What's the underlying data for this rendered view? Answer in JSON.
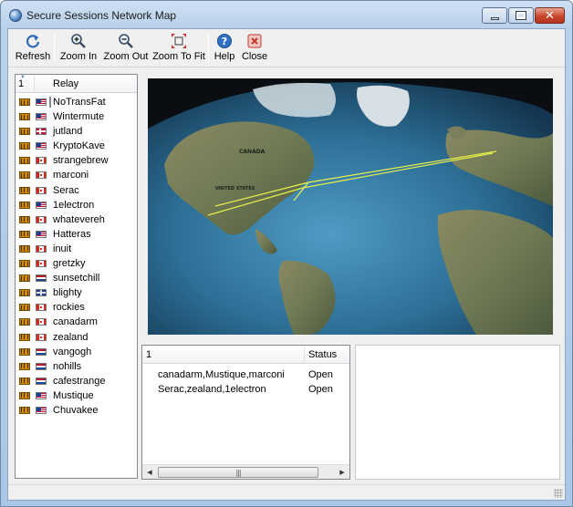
{
  "window": {
    "title": "Secure Sessions Network Map",
    "controls": {
      "minimize": "minimize",
      "maximize": "maximize",
      "close": "close"
    }
  },
  "toolbar": {
    "refresh_label": "Refresh",
    "zoom_in_label": "Zoom In",
    "zoom_out_label": "Zoom Out",
    "zoom_to_fit_label": "Zoom To Fit",
    "help_label": "Help",
    "close_label": "Close",
    "icons": {
      "refresh": "refresh-icon",
      "zoom_in": "magnifier-plus-icon",
      "zoom_out": "magnifier-minus-icon",
      "zoom_to_fit": "fit-arrows-icon",
      "help": "help-question-icon",
      "close": "close-x-icon"
    }
  },
  "relay_table": {
    "columns": {
      "count": "1",
      "relay": "Relay"
    },
    "rows": [
      {
        "name": "NoTransFat",
        "flag": "us"
      },
      {
        "name": "Wintermute",
        "flag": "us"
      },
      {
        "name": "jutland",
        "flag": "dk"
      },
      {
        "name": "KryptoKave",
        "flag": "us"
      },
      {
        "name": "strangebrew",
        "flag": "ca"
      },
      {
        "name": "marconi",
        "flag": "ca"
      },
      {
        "name": "Serac",
        "flag": "ca"
      },
      {
        "name": "1electron",
        "flag": "us"
      },
      {
        "name": "whatevereh",
        "flag": "ca"
      },
      {
        "name": "Hatteras",
        "flag": "us"
      },
      {
        "name": "inuit",
        "flag": "ca"
      },
      {
        "name": "gretzky",
        "flag": "ca"
      },
      {
        "name": "sunsetchill",
        "flag": "nl"
      },
      {
        "name": "blighty",
        "flag": "gb"
      },
      {
        "name": "rockies",
        "flag": "ca"
      },
      {
        "name": "canadarm",
        "flag": "ca"
      },
      {
        "name": "zealand",
        "flag": "ca"
      },
      {
        "name": "vangogh",
        "flag": "nl"
      },
      {
        "name": "nohills",
        "flag": "nl"
      },
      {
        "name": "cafestrange",
        "flag": "nl"
      },
      {
        "name": "Mustique",
        "flag": "us"
      },
      {
        "name": "Chuvakee",
        "flag": "us"
      }
    ]
  },
  "map": {
    "labels": {
      "canada": "CANADA",
      "united_states": "UNITED STATES"
    },
    "connection_color": "#e8f04a"
  },
  "sessions_table": {
    "columns": {
      "count": "1",
      "status": "Status"
    },
    "rows": [
      {
        "route": "canadarm,Mustique,marconi",
        "status": "Open"
      },
      {
        "route": "Serac,zealand,1electron",
        "status": "Open"
      }
    ],
    "scroll_grip": "|||"
  },
  "colors": {
    "titlebar": "#b9d1ea",
    "close_button": "#c8462c",
    "ocean": "#2d6f96",
    "land": "#6f7a55"
  }
}
